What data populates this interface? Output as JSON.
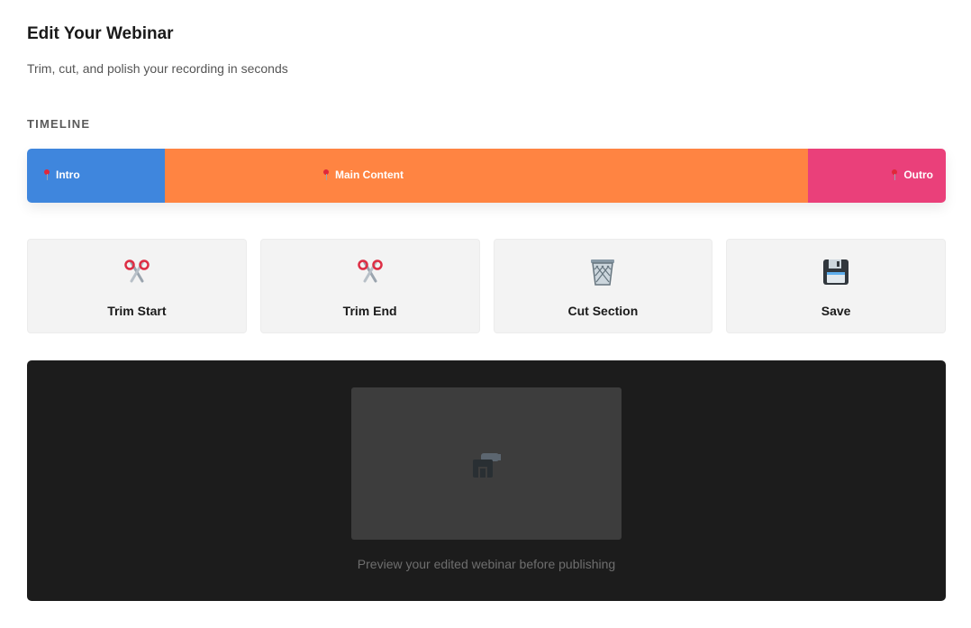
{
  "header": {
    "title": "Edit Your Webinar",
    "subtitle": "Trim, cut, and polish your recording in seconds"
  },
  "timeline": {
    "label": "TIMELINE",
    "segments": [
      {
        "label": "Intro",
        "color": "#3f86dd",
        "icon": "pushpin-icon",
        "share": 0.15
      },
      {
        "label": "Main Content",
        "color": "#ff8442",
        "icon": "pushpin-icon",
        "share": 0.7
      },
      {
        "label": "Outro",
        "color": "#ea407a",
        "icon": "pushpin-icon",
        "share": 0.15
      }
    ]
  },
  "tools": [
    {
      "label": "Trim Start",
      "icon": "scissors-icon"
    },
    {
      "label": "Trim End",
      "icon": "scissors-icon"
    },
    {
      "label": "Cut Section",
      "icon": "wastebasket-icon"
    },
    {
      "label": "Save",
      "icon": "floppy-disk-icon"
    }
  ],
  "preview": {
    "icon": "video-camera-icon",
    "caption": "Preview your edited webinar before publishing"
  }
}
